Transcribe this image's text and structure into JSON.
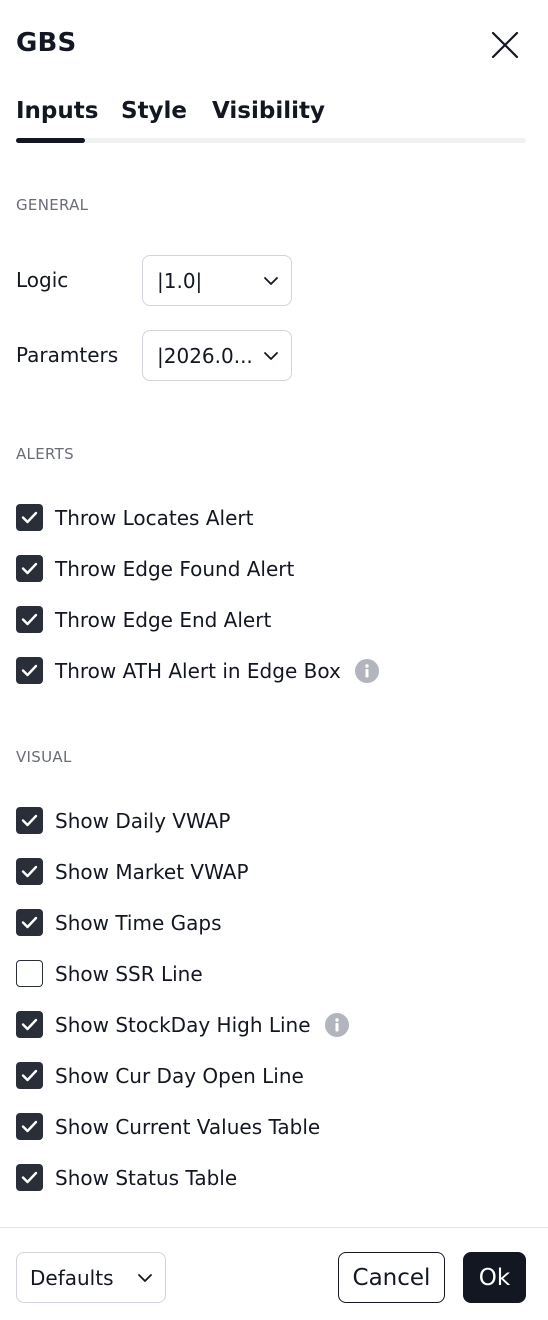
{
  "dialog": {
    "title": "GBS"
  },
  "tabs": [
    {
      "label": "Inputs",
      "active": true
    },
    {
      "label": "Style",
      "active": false
    },
    {
      "label": "Visibility",
      "active": false
    }
  ],
  "general": {
    "section_label": "GENERAL",
    "fields": [
      {
        "label": "Logic",
        "value": "|1.0|"
      },
      {
        "label": "Paramters",
        "value": "|2026.0..."
      }
    ]
  },
  "alerts": {
    "section_label": "ALERTS",
    "items": [
      {
        "label": "Throw Locates Alert",
        "checked": true,
        "info": false
      },
      {
        "label": "Throw Edge Found Alert",
        "checked": true,
        "info": false
      },
      {
        "label": "Throw Edge End Alert",
        "checked": true,
        "info": false
      },
      {
        "label": "Throw ATH Alert in Edge Box",
        "checked": true,
        "info": true
      }
    ]
  },
  "visual": {
    "section_label": "VISUAL",
    "items": [
      {
        "label": "Show Daily VWAP",
        "checked": true,
        "info": false
      },
      {
        "label": "Show Market VWAP",
        "checked": true,
        "info": false
      },
      {
        "label": "Show Time Gaps",
        "checked": true,
        "info": false
      },
      {
        "label": "Show SSR Line",
        "checked": false,
        "info": false
      },
      {
        "label": "Show StockDay High Line",
        "checked": true,
        "info": true
      },
      {
        "label": "Show Cur Day Open Line",
        "checked": true,
        "info": false
      },
      {
        "label": "Show Current Values Table",
        "checked": true,
        "info": false
      },
      {
        "label": "Show Status Table",
        "checked": true,
        "info": false
      }
    ]
  },
  "footer": {
    "defaults_label": "Defaults",
    "cancel_label": "Cancel",
    "ok_label": "Ok"
  },
  "colors": {
    "text": "#131722",
    "checkbox_checked": "#2a2e39",
    "info_icon": "#b2b5be",
    "section_label": "#6a6d78",
    "ok_button": "#131722"
  }
}
